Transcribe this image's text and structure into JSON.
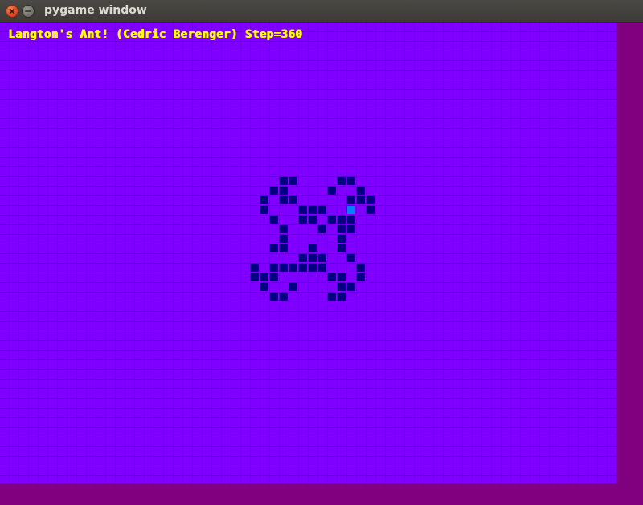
{
  "window": {
    "title": "pygame window"
  },
  "game": {
    "status_text": "Langton's Ant! (Cedric Berenger) Step=360",
    "step": 360,
    "colors": {
      "background": "#8000ff",
      "grid_line": "#7a0080",
      "black_cell": "#000080",
      "ant": "#0080ff",
      "text": "#ffff00",
      "window_bg": "#800080"
    },
    "grid": {
      "columns": 64,
      "rows": 48
    },
    "black_cells": [
      [
        29,
        16
      ],
      [
        30,
        16
      ],
      [
        35,
        16
      ],
      [
        36,
        16
      ],
      [
        28,
        17
      ],
      [
        29,
        17
      ],
      [
        34,
        17
      ],
      [
        37,
        17
      ],
      [
        27,
        18
      ],
      [
        29,
        18
      ],
      [
        30,
        18
      ],
      [
        36,
        18
      ],
      [
        37,
        18
      ],
      [
        38,
        18
      ],
      [
        27,
        19
      ],
      [
        31,
        19
      ],
      [
        32,
        19
      ],
      [
        33,
        19
      ],
      [
        38,
        19
      ],
      [
        28,
        20
      ],
      [
        31,
        20
      ],
      [
        32,
        20
      ],
      [
        34,
        20
      ],
      [
        35,
        20
      ],
      [
        36,
        20
      ],
      [
        29,
        21
      ],
      [
        33,
        21
      ],
      [
        35,
        21
      ],
      [
        36,
        21
      ],
      [
        29,
        22
      ],
      [
        35,
        22
      ],
      [
        28,
        23
      ],
      [
        29,
        23
      ],
      [
        32,
        23
      ],
      [
        35,
        23
      ],
      [
        31,
        24
      ],
      [
        32,
        24
      ],
      [
        33,
        24
      ],
      [
        36,
        24
      ],
      [
        26,
        25
      ],
      [
        28,
        25
      ],
      [
        29,
        25
      ],
      [
        30,
        25
      ],
      [
        31,
        25
      ],
      [
        32,
        25
      ],
      [
        33,
        25
      ],
      [
        37,
        25
      ],
      [
        26,
        26
      ],
      [
        27,
        26
      ],
      [
        28,
        26
      ],
      [
        34,
        26
      ],
      [
        35,
        26
      ],
      [
        37,
        26
      ],
      [
        27,
        27
      ],
      [
        30,
        27
      ],
      [
        35,
        27
      ],
      [
        36,
        27
      ],
      [
        28,
        28
      ],
      [
        29,
        28
      ],
      [
        34,
        28
      ],
      [
        35,
        28
      ]
    ],
    "ant": {
      "col": 36,
      "row": 19
    }
  }
}
